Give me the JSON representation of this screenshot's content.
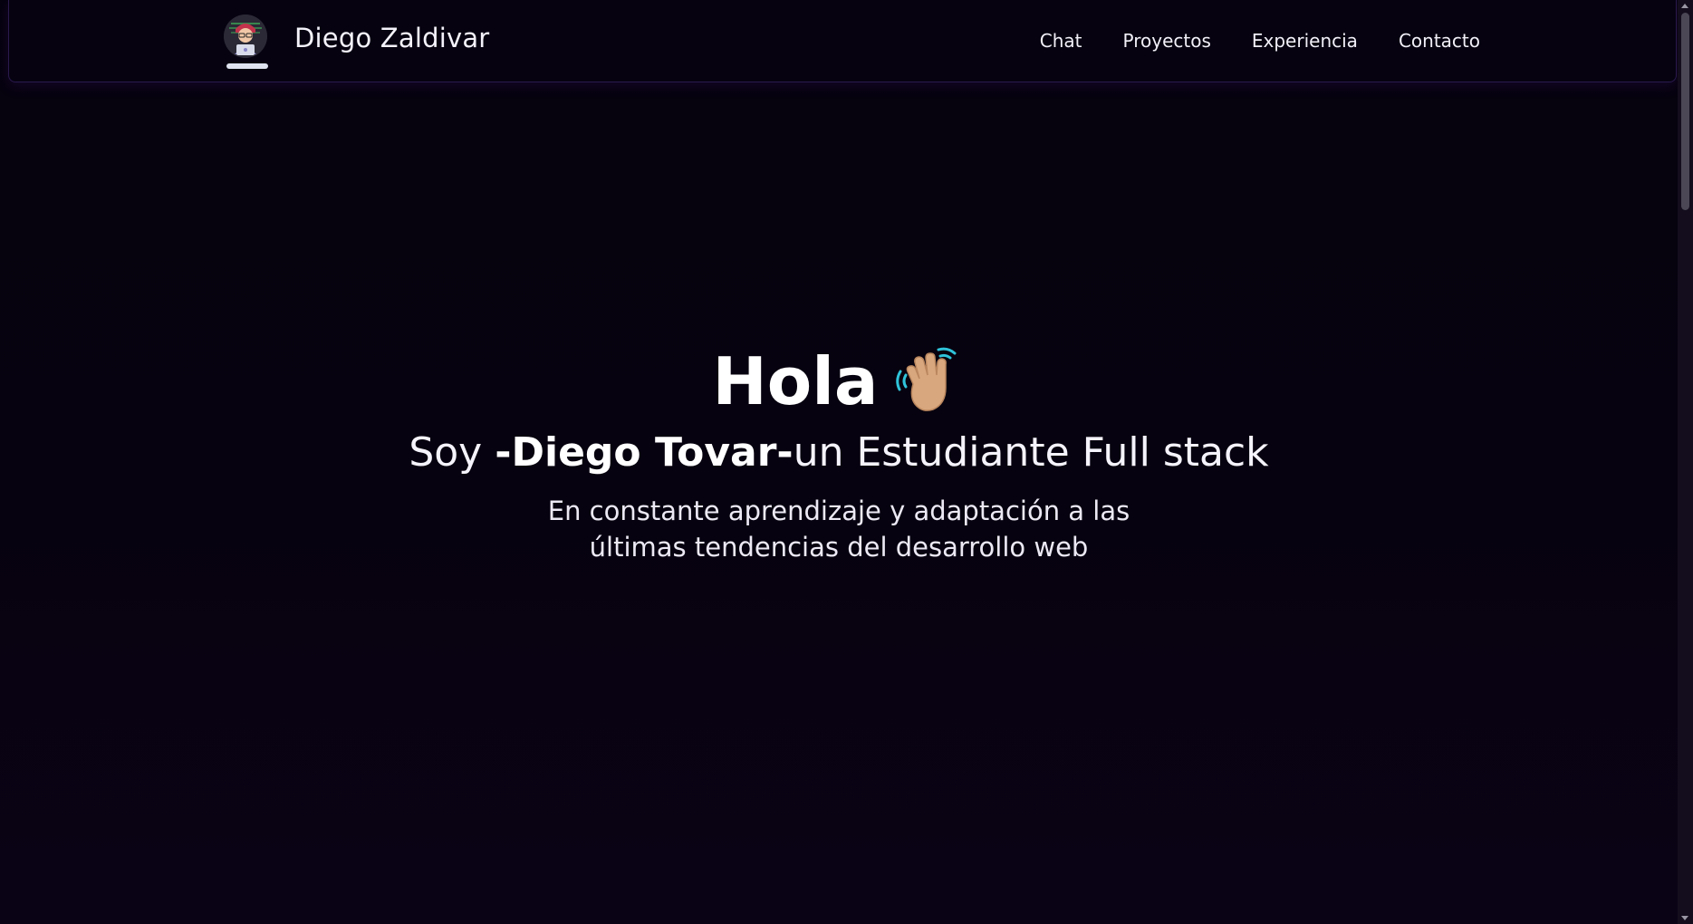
{
  "header": {
    "brand_name": "Diego Zaldivar",
    "nav": [
      {
        "label": "Chat"
      },
      {
        "label": "Proyectos"
      },
      {
        "label": "Experiencia"
      },
      {
        "label": "Contacto"
      }
    ]
  },
  "hero": {
    "greeting": "Hola",
    "wave_icon": "waving-hand",
    "subtitle_prefix": "Soy ",
    "subtitle_name": "-Diego Tovar-",
    "subtitle_suffix": "un Estudiante Full stack",
    "description": "En constante aprendizaje y adaptación a las últimas tendencias del desarrollo web"
  },
  "colors": {
    "background": "#07020f",
    "header_border": "#2a1a4e",
    "text": "#ffffff",
    "wave_skin": "#d9a77d",
    "wave_motion": "#2fc3d9"
  }
}
